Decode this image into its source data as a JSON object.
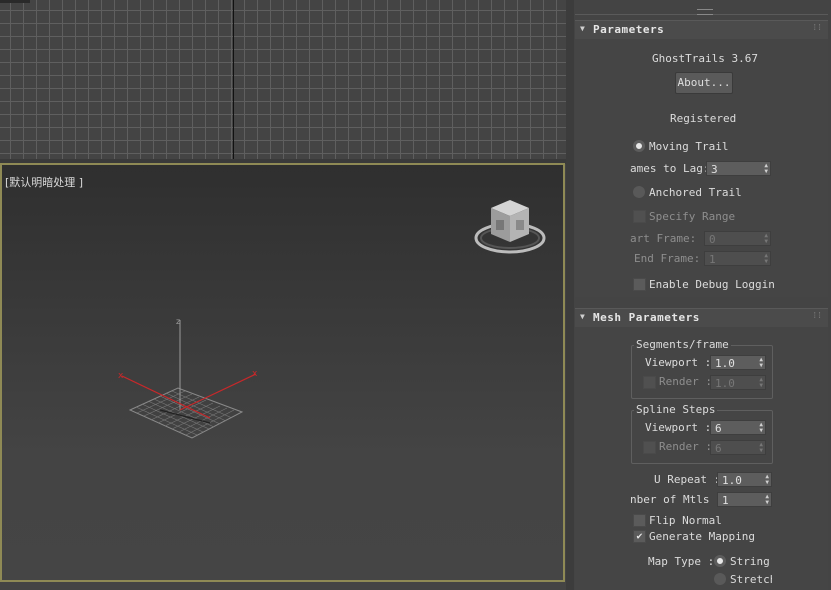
{
  "viewport": {
    "label": "[默认明暗处理 ]"
  },
  "parameters": {
    "title": "Parameters",
    "version": "GhostTrails 3.67",
    "about_button": "About...",
    "status": "Registered",
    "moving_trail": {
      "label": "Moving Trail",
      "selected": true
    },
    "frames_to_lag": {
      "label": "ames to Lag:",
      "value": "3"
    },
    "anchored_trail": {
      "label": "Anchored Trail",
      "selected": false
    },
    "specify_range": {
      "label": "Specify Range"
    },
    "start_frame": {
      "label": "art Frame:",
      "value": "0"
    },
    "end_frame": {
      "label": "End Frame:",
      "value": "1"
    },
    "debug": {
      "label": "Enable Debug Loggin"
    }
  },
  "mesh": {
    "title": "Mesh Parameters",
    "segments": {
      "title": "Segments/frame",
      "viewport_label": "Viewport :",
      "viewport_value": "1.0",
      "render_label": "Render :",
      "render_value": "1.0"
    },
    "spline": {
      "title": "Spline Steps",
      "viewport_label": "Viewport :",
      "viewport_value": "6",
      "render_label": "Render :",
      "render_value": "6"
    },
    "u_repeat": {
      "label": "U Repeat :",
      "value": "1.0"
    },
    "num_mtls": {
      "label": "nber of Mtls :",
      "value": "1"
    },
    "flip_normal": {
      "label": "Flip Normal"
    },
    "gen_mapping": {
      "label": "Generate Mapping",
      "checked": true
    },
    "map_type": {
      "label": "Map Type :",
      "opt1": "String",
      "opt2": "Stretch"
    }
  },
  "colors": {
    "viewport_border": "#8f8a55",
    "axis_x": "#c8282a"
  }
}
